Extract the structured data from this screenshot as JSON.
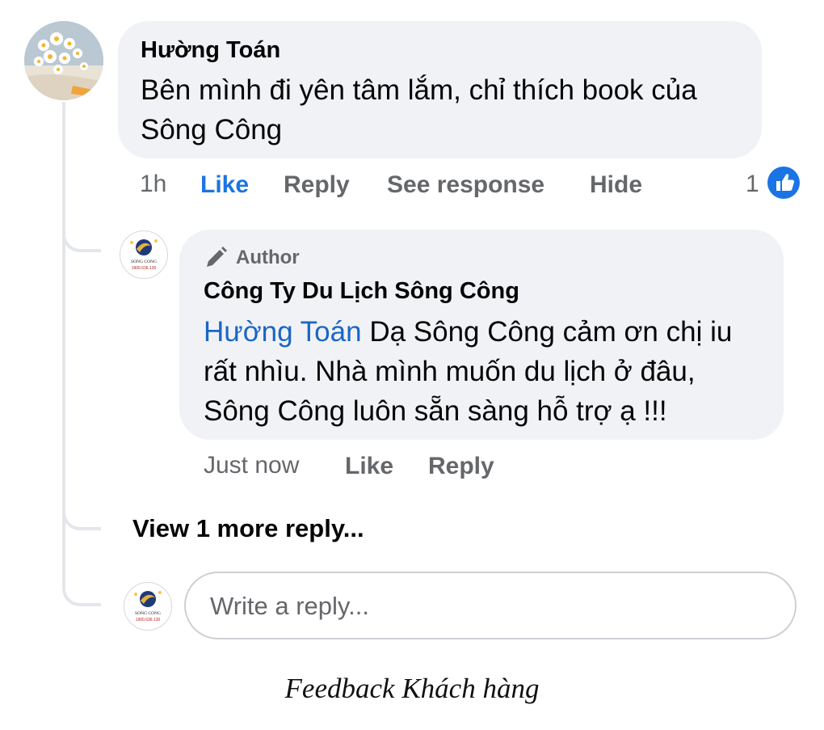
{
  "comment": {
    "author": "Hường Toán",
    "text": "Bên mình đi yên tâm lắm, chỉ thích book của Sông Công",
    "time": "1h",
    "actions": {
      "like": "Like",
      "reply": "Reply",
      "see_response": "See response",
      "hide": "Hide"
    },
    "reaction_count": "1"
  },
  "reply": {
    "badge": "Author",
    "author": "Công Ty Du Lịch Sông Công",
    "mention": "Hường Toán",
    "text": "Dạ Sông Công cảm ơn chị iu rất nhìu. Nhà mình muốn du lịch ở đâu, Sông Công luôn sẵn sàng hỗ trợ ạ !!!",
    "time": "Just now",
    "actions": {
      "like": "Like",
      "reply": "Reply"
    }
  },
  "thread": {
    "view_more": "View 1 more reply..."
  },
  "composer": {
    "placeholder": "Write a reply..."
  },
  "logo": {
    "name": "SONG CONG",
    "phone": "1900.636.130"
  },
  "caption": "Feedback Khách hàng",
  "colors": {
    "bubble": "#f0f2f5",
    "like_blue": "#1b74e4",
    "mention_blue": "#1b65c6",
    "meta_gray": "#65676b"
  }
}
